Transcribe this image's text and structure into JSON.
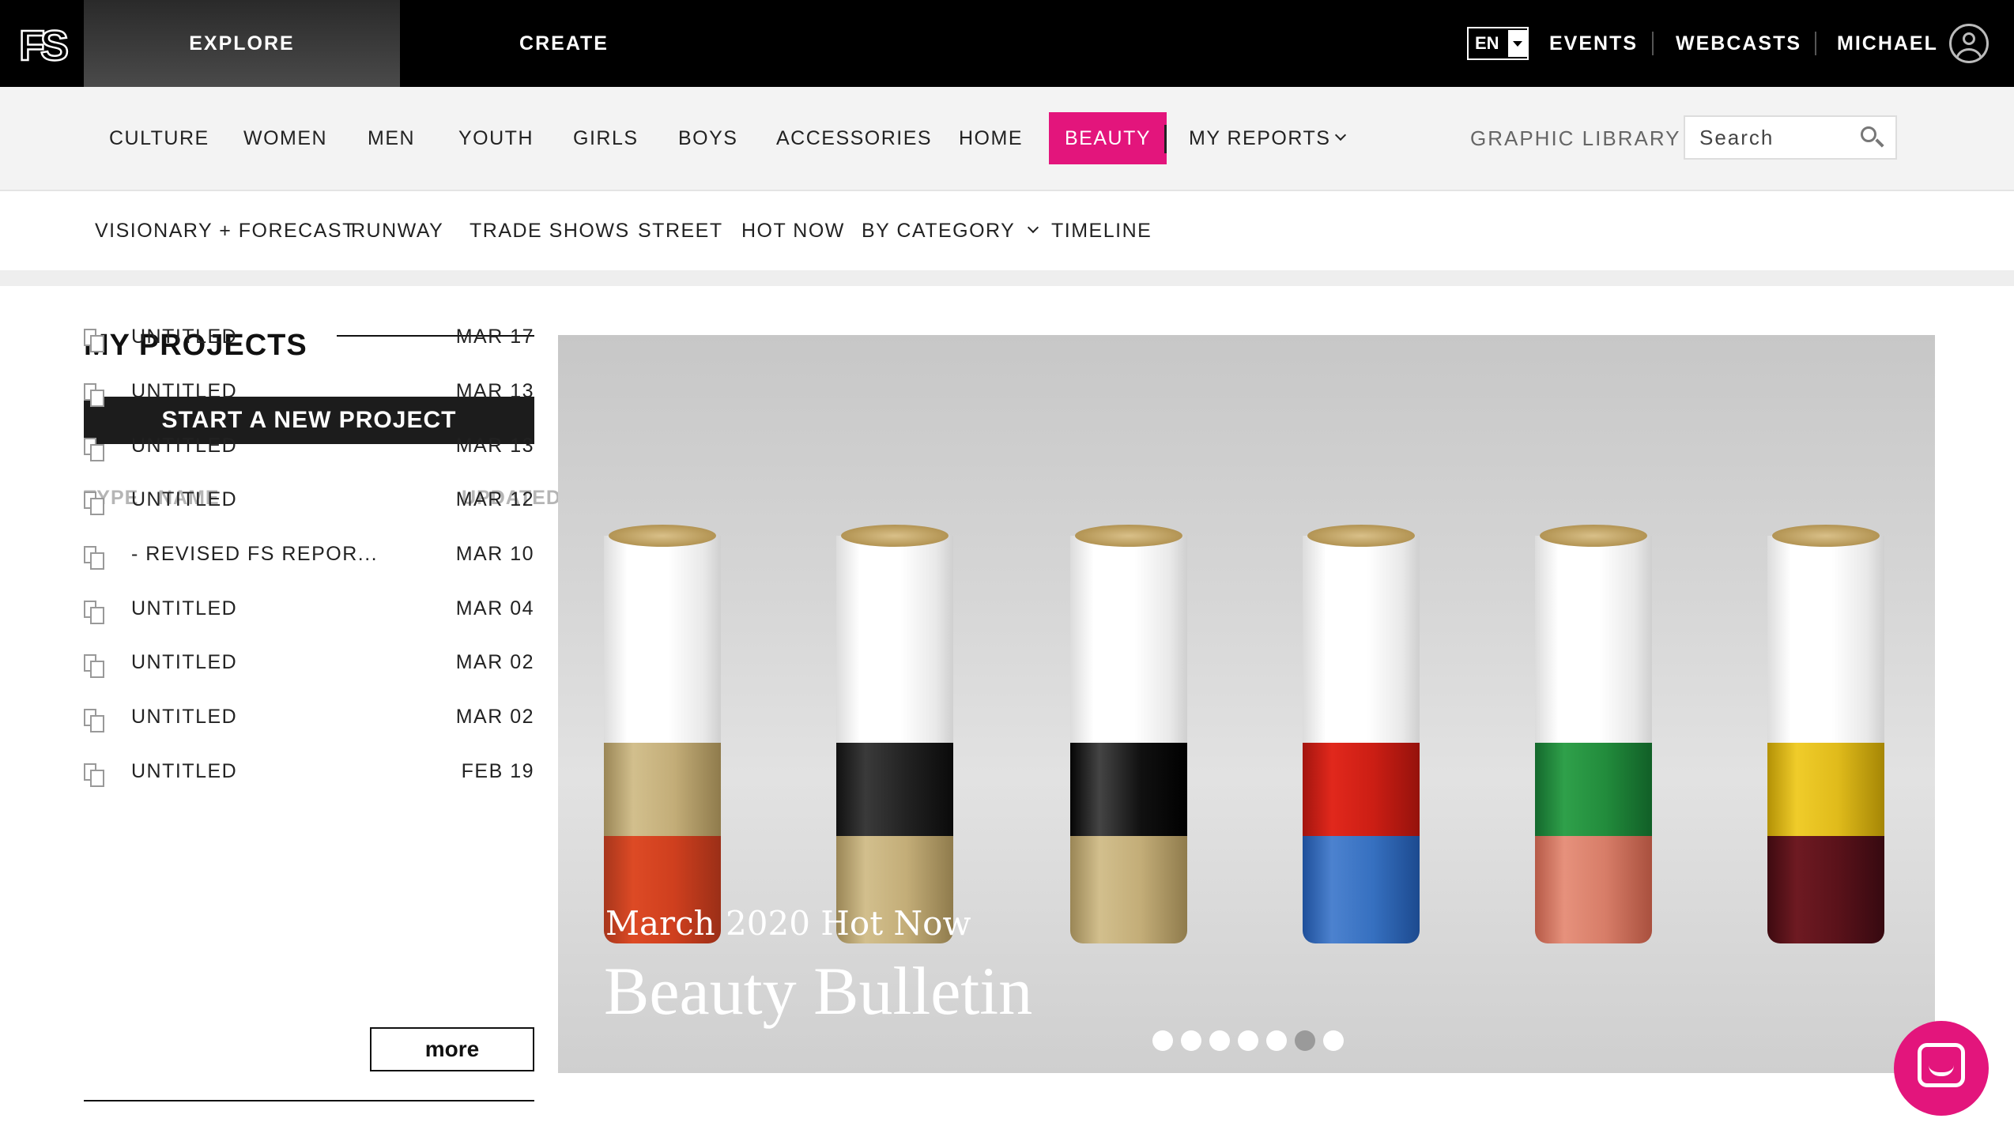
{
  "topbar": {
    "logo_text": "FS",
    "tabs": [
      {
        "label": "EXPLORE",
        "active": true
      },
      {
        "label": "CREATE",
        "active": false
      }
    ],
    "language": "EN",
    "links": [
      "EVENTS",
      "WEBCASTS",
      "MICHAEL"
    ]
  },
  "catnav": {
    "items": [
      "CULTURE",
      "WOMEN",
      "MEN",
      "YOUTH",
      "GIRLS",
      "BOYS",
      "ACCESSORIES",
      "HOME",
      "BEAUTY"
    ],
    "active": "BEAUTY",
    "my_reports": "MY REPORTS",
    "graphic_library": "GRAPHIC LIBRARY",
    "search_placeholder": "Search"
  },
  "subnav": {
    "items": [
      "VISIONARY + FORECAST",
      "RUNWAY",
      "TRADE SHOWS",
      "STREET",
      "HOT NOW",
      "BY CATEGORY",
      "TIMELINE"
    ]
  },
  "projects": {
    "title": "MY PROJECTS",
    "new_button": "START A NEW PROJECT",
    "columns": {
      "type": "TYPE",
      "name": "NAME",
      "updated": "UPDATED"
    },
    "rows": [
      {
        "name": "UNTITLED",
        "date": "MAR 17"
      },
      {
        "name": "UNTITLED",
        "date": "MAR 13"
      },
      {
        "name": "UNTITLED",
        "date": "MAR 13"
      },
      {
        "name": "UNTITLED",
        "date": "MAR 12"
      },
      {
        "name": "- REVISED FS REPOR...",
        "date": "MAR 10"
      },
      {
        "name": "UNTITLED",
        "date": "MAR 04"
      },
      {
        "name": "UNTITLED",
        "date": "MAR 02"
      },
      {
        "name": "UNTITLED",
        "date": "MAR 02"
      },
      {
        "name": "UNTITLED",
        "date": "FEB 19"
      }
    ],
    "more_label": "more"
  },
  "hero": {
    "subtitle": "March 2020 Hot Now",
    "title": "Beauty Bulletin",
    "slide_count": 7,
    "active_slide": 6
  },
  "colors": {
    "accent": "#e3157c",
    "topbar": "#000000"
  }
}
